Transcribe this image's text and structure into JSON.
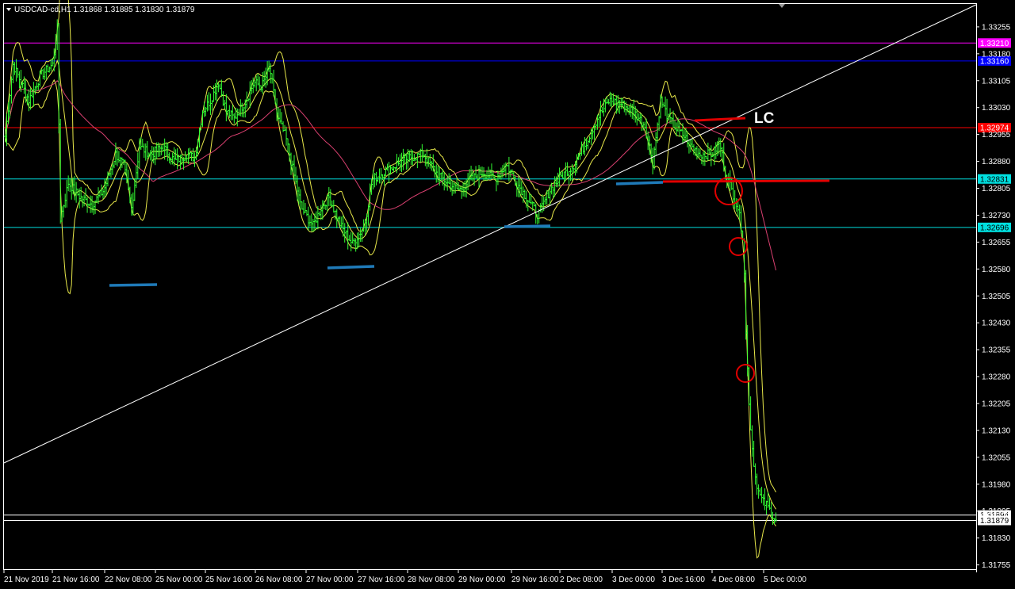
{
  "window": {
    "title": "USDCAD-cd,H1  1.31868 1.31885 1.31830 1.31879",
    "menu_icon": "triangle-down-icon",
    "scroll_marker_icon": "triangle-down-icon"
  },
  "colors": {
    "background": "#000000",
    "frame": "#ffffff",
    "candles": "#33ff33",
    "bollinger": "#e8e84a",
    "moving_average": "#d94070",
    "trendline": "#ffffff",
    "magenta_level": "#ff00ff",
    "blue_level": "#0000ff",
    "red_level": "#ff0000",
    "cyan_level": "#00e0e0",
    "support_marks": "#1f7ab8",
    "marker_red": "#e00000"
  },
  "chart_data": {
    "type": "candlestick",
    "symbol": "USDCAD-cd",
    "timeframe": "H1",
    "ohlc": {
      "open": "1.31868",
      "high": "1.31885",
      "low": "1.31830",
      "close": "1.31879"
    },
    "ylim": [
      1.31742,
      1.3332
    ],
    "y_ticks": [
      "1.33255",
      "1.33180",
      "1.33105",
      "1.33030",
      "1.32955",
      "1.32880",
      "1.32805",
      "1.32730",
      "1.32655",
      "1.32580",
      "1.32505",
      "1.32430",
      "1.32355",
      "1.32280",
      "1.32205",
      "1.32130",
      "1.32055",
      "1.31980",
      "1.31905",
      "1.31830",
      "1.31755"
    ],
    "x_ticks": [
      "21 Nov 2019",
      "21 Nov 16:00",
      "22 Nov 08:00",
      "25 Nov 00:00",
      "25 Nov 16:00",
      "26 Nov 08:00",
      "27 Nov 00:00",
      "27 Nov 16:00",
      "28 Nov 08:00",
      "29 Nov 00:00",
      "29 Nov 16:00",
      "2 Dec 08:00",
      "3 Dec 00:00",
      "3 Dec 16:00",
      "4 Dec 08:00",
      "5 Dec 00:00"
    ],
    "price_levels": [
      {
        "price": 1.3321,
        "label": "1.33210",
        "color": "#ff00ff"
      },
      {
        "price": 1.3316,
        "label": "1.33160",
        "color": "#0000ff"
      },
      {
        "price": 1.32974,
        "label": "1.32974",
        "color": "#ff0000"
      },
      {
        "price": 1.32831,
        "label": "1.32831",
        "color": "#00e0e0"
      },
      {
        "price": 1.32696,
        "label": "1.32696",
        "color": "#00e0e0"
      },
      {
        "price": 1.31894,
        "label": "1.31894",
        "color": "#ffffff"
      },
      {
        "price": 1.31879,
        "label": "1.31879",
        "color": "#ffffff"
      }
    ],
    "annotations": {
      "lc_label": "LC"
    },
    "series": [
      {
        "kind": "bars",
        "color": "#33ff33",
        "path_close": [
          [
            0,
            1.3295
          ],
          [
            10,
            1.3315
          ],
          [
            20,
            1.331
          ],
          [
            30,
            1.3305
          ],
          [
            45,
            1.3312
          ],
          [
            60,
            1.3315
          ],
          [
            66,
            1.3325
          ],
          [
            70,
            1.3272
          ],
          [
            80,
            1.3282
          ],
          [
            95,
            1.3278
          ],
          [
            110,
            1.3276
          ],
          [
            125,
            1.328
          ],
          [
            140,
            1.329
          ],
          [
            150,
            1.3287
          ],
          [
            160,
            1.3275
          ],
          [
            170,
            1.3292
          ],
          [
            185,
            1.329
          ],
          [
            200,
            1.3292
          ],
          [
            215,
            1.3288
          ],
          [
            230,
            1.329
          ],
          [
            240,
            1.3289
          ],
          [
            250,
            1.3302
          ],
          [
            260,
            1.3305
          ],
          [
            270,
            1.331
          ],
          [
            280,
            1.3302
          ],
          [
            290,
            1.33
          ],
          [
            305,
            1.3305
          ],
          [
            315,
            1.331
          ],
          [
            325,
            1.3309
          ],
          [
            335,
            1.3314
          ],
          [
            345,
            1.33
          ],
          [
            355,
            1.3295
          ],
          [
            365,
            1.3285
          ],
          [
            375,
            1.3275
          ],
          [
            390,
            1.327
          ],
          [
            400,
            1.3275
          ],
          [
            410,
            1.3278
          ],
          [
            425,
            1.327
          ],
          [
            440,
            1.3265
          ],
          [
            455,
            1.327
          ],
          [
            465,
            1.3283
          ],
          [
            480,
            1.3285
          ],
          [
            495,
            1.3287
          ],
          [
            510,
            1.3289
          ],
          [
            530,
            1.329
          ],
          [
            545,
            1.3285
          ],
          [
            560,
            1.3282
          ],
          [
            575,
            1.328
          ],
          [
            590,
            1.3283
          ],
          [
            605,
            1.3285
          ],
          [
            620,
            1.3283
          ],
          [
            635,
            1.3287
          ],
          [
            648,
            1.3282
          ],
          [
            660,
            1.3278
          ],
          [
            675,
            1.3273
          ],
          [
            690,
            1.328
          ],
          [
            705,
            1.3284
          ],
          [
            720,
            1.3287
          ],
          [
            735,
            1.3293
          ],
          [
            750,
            1.33
          ],
          [
            765,
            1.3305
          ],
          [
            780,
            1.3304
          ],
          [
            795,
            1.3302
          ],
          [
            810,
            1.3298
          ],
          [
            820,
            1.3288
          ],
          [
            830,
            1.3305
          ],
          [
            840,
            1.33
          ],
          [
            850,
            1.3297
          ],
          [
            860,
            1.3295
          ],
          [
            870,
            1.3292
          ],
          [
            880,
            1.329
          ],
          [
            895,
            1.329
          ],
          [
            905,
            1.3293
          ],
          [
            912,
            1.3285
          ],
          [
            920,
            1.328
          ],
          [
            928,
            1.3275
          ],
          [
            935,
            1.3266
          ],
          [
            938,
            1.324
          ],
          [
            941,
            1.3225
          ],
          [
            945,
            1.321
          ],
          [
            950,
            1.32
          ],
          [
            955,
            1.3195
          ],
          [
            960,
            1.3193
          ],
          [
            965,
            1.3192
          ],
          [
            970,
            1.319
          ],
          [
            976,
            1.3188
          ]
        ]
      }
    ]
  }
}
